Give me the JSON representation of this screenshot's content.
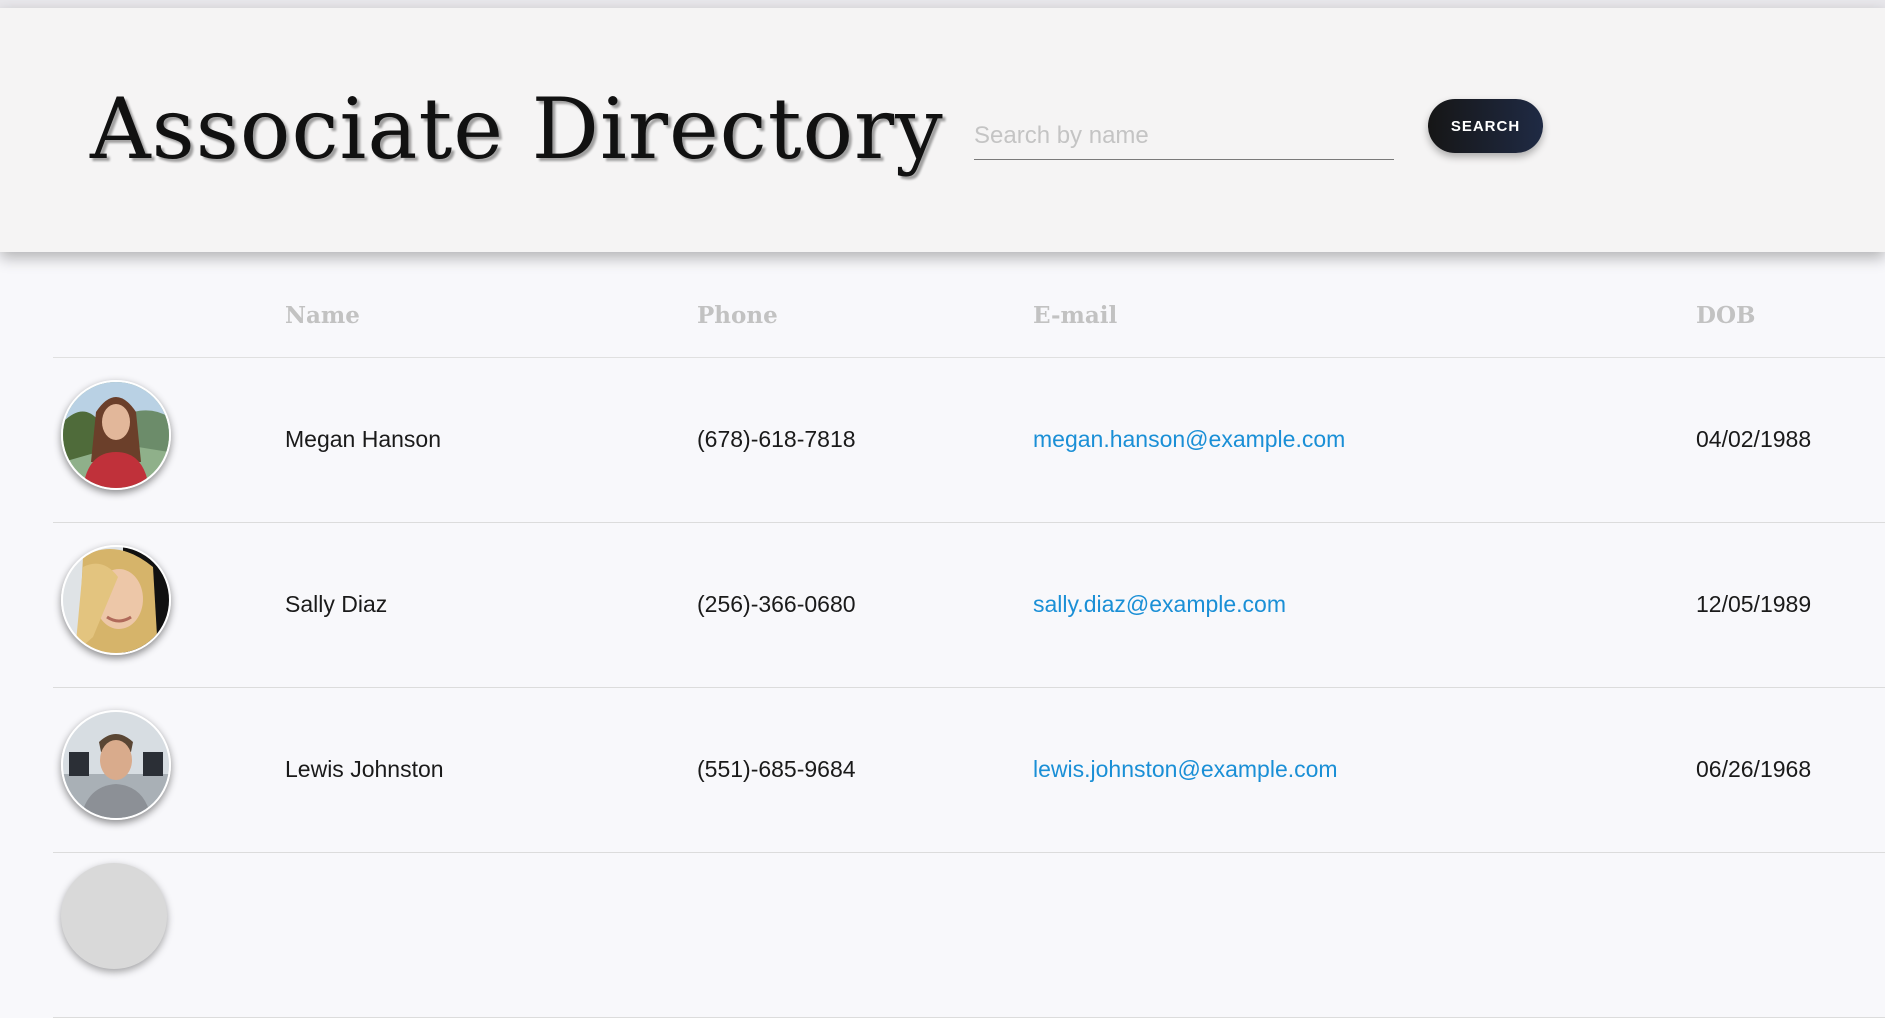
{
  "header": {
    "title": "Associate Directory",
    "search_placeholder": "Search by name",
    "search_value": "",
    "search_button_label": "SEARCH"
  },
  "table": {
    "columns": [
      "Name",
      "Phone",
      "E-mail",
      "DOB"
    ],
    "rows": [
      {
        "name": "Megan Hanson",
        "phone": "(678)-618-7818",
        "email": "megan.hanson@example.com",
        "dob": "04/02/1988"
      },
      {
        "name": "Sally Diaz",
        "phone": "(256)-366-0680",
        "email": "sally.diaz@example.com",
        "dob": "12/05/1989"
      },
      {
        "name": "Lewis Johnston",
        "phone": "(551)-685-9684",
        "email": "lewis.johnston@example.com",
        "dob": "06/26/1968"
      }
    ]
  },
  "colors": {
    "accent_link": "#1a8fd6",
    "header_bg": "#f5f4f4",
    "button_bg": "#161616",
    "page_bg": "#f8f8fb"
  }
}
